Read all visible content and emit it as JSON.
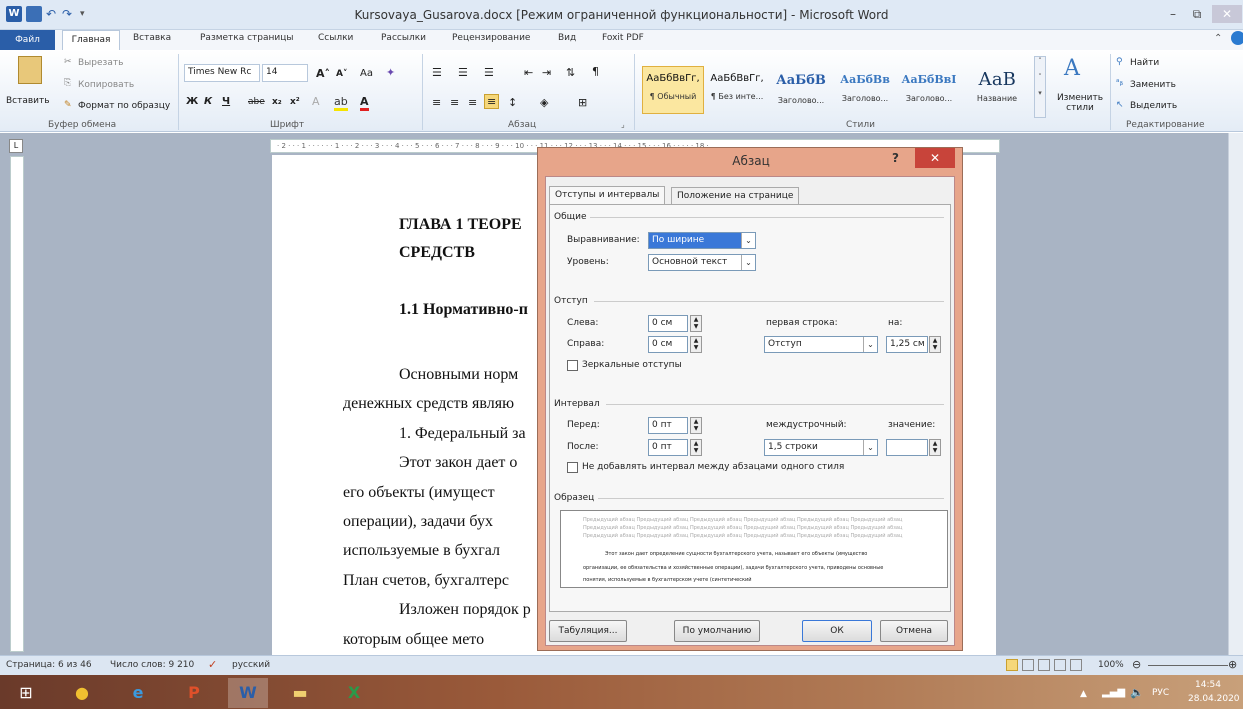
{
  "window": {
    "title": "Kursovaya_Gusarova.docx [Режим ограниченной функциональности]  -  Microsoft Word",
    "minimize": "–",
    "restore": "⧉",
    "close": "✕"
  },
  "tabs": [
    "Файл",
    "Главная",
    "Вставка",
    "Разметка страницы",
    "Ссылки",
    "Рассылки",
    "Рецензирование",
    "Вид",
    "Foxit PDF"
  ],
  "ribbon": {
    "clipboard": {
      "paste": "Вставить",
      "cut": "Вырезать",
      "copy": "Копировать",
      "format_painter": "Формат по образцу",
      "label": "Буфер обмена"
    },
    "font": {
      "name": "Times New Rc",
      "size": "14",
      "grow": "A˄",
      "shrink": "A˅",
      "case": "Aa",
      "bold": "Ж",
      "italic": "К",
      "underline": "Ч",
      "strike": "abe",
      "sub": "x₂",
      "sup": "x²",
      "label": "Шрифт"
    },
    "paragraph": {
      "label": "Абзац"
    },
    "styles": {
      "label": "Стили",
      "items": [
        {
          "sample": "АаБбВвГг,",
          "name": "¶ Обычный"
        },
        {
          "sample": "АаБбВвГг,",
          "name": "¶ Без инте..."
        },
        {
          "sample": "АаБбВ",
          "name": "Заголово..."
        },
        {
          "sample": "АаБбВв",
          "name": "Заголово..."
        },
        {
          "sample": "АаБбВвІ",
          "name": "Заголово..."
        },
        {
          "sample": "АаВ",
          "name": "Название"
        }
      ],
      "change": "Изменить стили"
    },
    "editing": {
      "label": "Редактирование",
      "find": "Найти",
      "replace": "Заменить",
      "select": "Выделить"
    }
  },
  "ruler": {
    "marks": "· 2 · · · 1 · · · · · · 1 · · · 2 · · · 3 · · · 4 · · · 5 · · · 6 · · · 7 · · · 8 · · · 9 · · · 10 · · · 11 · · · 12 · · · 13 · · · 14 · · · 15 · · · 16 · · · · · 18 ·"
  },
  "document": {
    "lines": [
      "ГЛАВА 1 ТЕОРЕ",
      "СРЕДСТВ",
      "1.1 Нормативно-п",
      "Основными    норм",
      "денежных средств являю",
      "1. Федеральный за",
      "Этот закон дает о",
      "его  объекты  (имущест",
      "операции),  задачи  бух",
      "используемые  в  бухгал",
      "План счетов, бухгалтерс",
      "Изложен порядок р",
      "которым   общее   мето"
    ]
  },
  "status": {
    "page": "Страница: 6 из 46",
    "words": "Число слов: 9 210",
    "lang": "русский",
    "zoom": "100%"
  },
  "tray": {
    "lang": "РУС",
    "time": "14:54",
    "date": "28.04.2020"
  },
  "dialog": {
    "title": "Абзац",
    "help": "?",
    "close": "✕",
    "tab1": "Отступы и интервалы",
    "tab2": "Положение на странице",
    "general": "Общие",
    "align_label": "Выравнивание:",
    "align_value": "По ширине",
    "level_label": "Уровень:",
    "level_value": "Основной текст",
    "indent": "Отступ",
    "left_label": "Слева:",
    "left_value": "0 см",
    "right_label": "Справа:",
    "right_value": "0 см",
    "first_line_label": "первая строка:",
    "first_line_value": "Отступ",
    "by_label": "на:",
    "by_value": "1,25 см",
    "mirror": "Зеркальные отступы",
    "spacing": "Интервал",
    "before_label": "Перед:",
    "before_value": "0 пт",
    "after_label": "После:",
    "after_value": "0 пт",
    "line_label": "междустрочный:",
    "line_value": "1,5 строки",
    "value_label": "значение:",
    "no_space": "Не добавлять интервал между абзацами одного стиля",
    "preview": "Образец",
    "preview_prev": "Предыдущий абзац Предыдущий абзац Предыдущий абзац Предыдущий абзац Предыдущий абзац Предыдущий абзац",
    "preview_text1": "Этот закон дает определение сущности бухгалтерского учета, называет его объекты (имущество",
    "preview_text2": "организации, ее обязательства и хозяйственные операции), задачи бухгалтерского учета, приводены основные",
    "preview_text3": "понятия, используемые в бухгалтерском учете (синтетический",
    "tabs_btn": "Табуляция...",
    "default_btn": "По умолчанию",
    "ok_btn": "ОК",
    "cancel_btn": "Отмена"
  }
}
